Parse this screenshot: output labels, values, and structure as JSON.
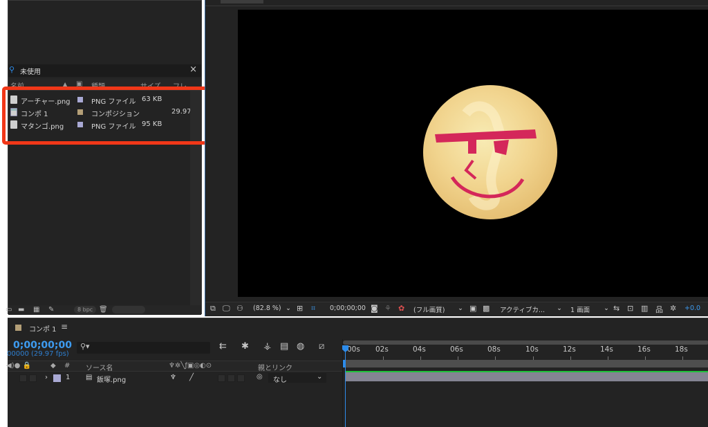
{
  "project": {
    "search_value": "未使用",
    "columns": [
      "名前",
      "種類",
      "サイズ",
      "フレ"
    ],
    "items": [
      {
        "name": "アーチャー.png",
        "label_color": "#a9a9d4",
        "type": "PNG ファイル",
        "size": "63 KB",
        "fps": ""
      },
      {
        "name": "コンポ 1",
        "label_color": "#b49f77",
        "type": "コンポジション",
        "size": "",
        "fps": "29.97"
      },
      {
        "name": "マタンゴ.png",
        "label_color": "#a9a9d4",
        "type": "PNG ファイル",
        "size": "95 KB",
        "fps": ""
      }
    ],
    "bpc": "8 bpc",
    "highlight_color": "#f13718"
  },
  "viewer": {
    "tab": "コンポ 1",
    "zoom": "(82.8 %)",
    "timecode": "0;00;00;00",
    "resolution": "(フル画質)",
    "camera": "アクティブカ...",
    "views": "1 画面",
    "exposure": "+0.0"
  },
  "timeline": {
    "comp_name": "コンポ 1",
    "timecode": "0;00;00;00",
    "fps": "00000 (29.97 fps)",
    "header": {
      "num": "#",
      "source": "ソース名",
      "parent": "親とリンク"
    },
    "layer": {
      "num": "1",
      "name": "飯塚.png",
      "parent": "なし"
    },
    "ruler": [
      "00s",
      "02s",
      "04s",
      "06s",
      "08s",
      "10s",
      "12s",
      "14s",
      "16s",
      "18s"
    ],
    "accent": "#2d8ceb",
    "layer_bar_color": "#848493"
  }
}
